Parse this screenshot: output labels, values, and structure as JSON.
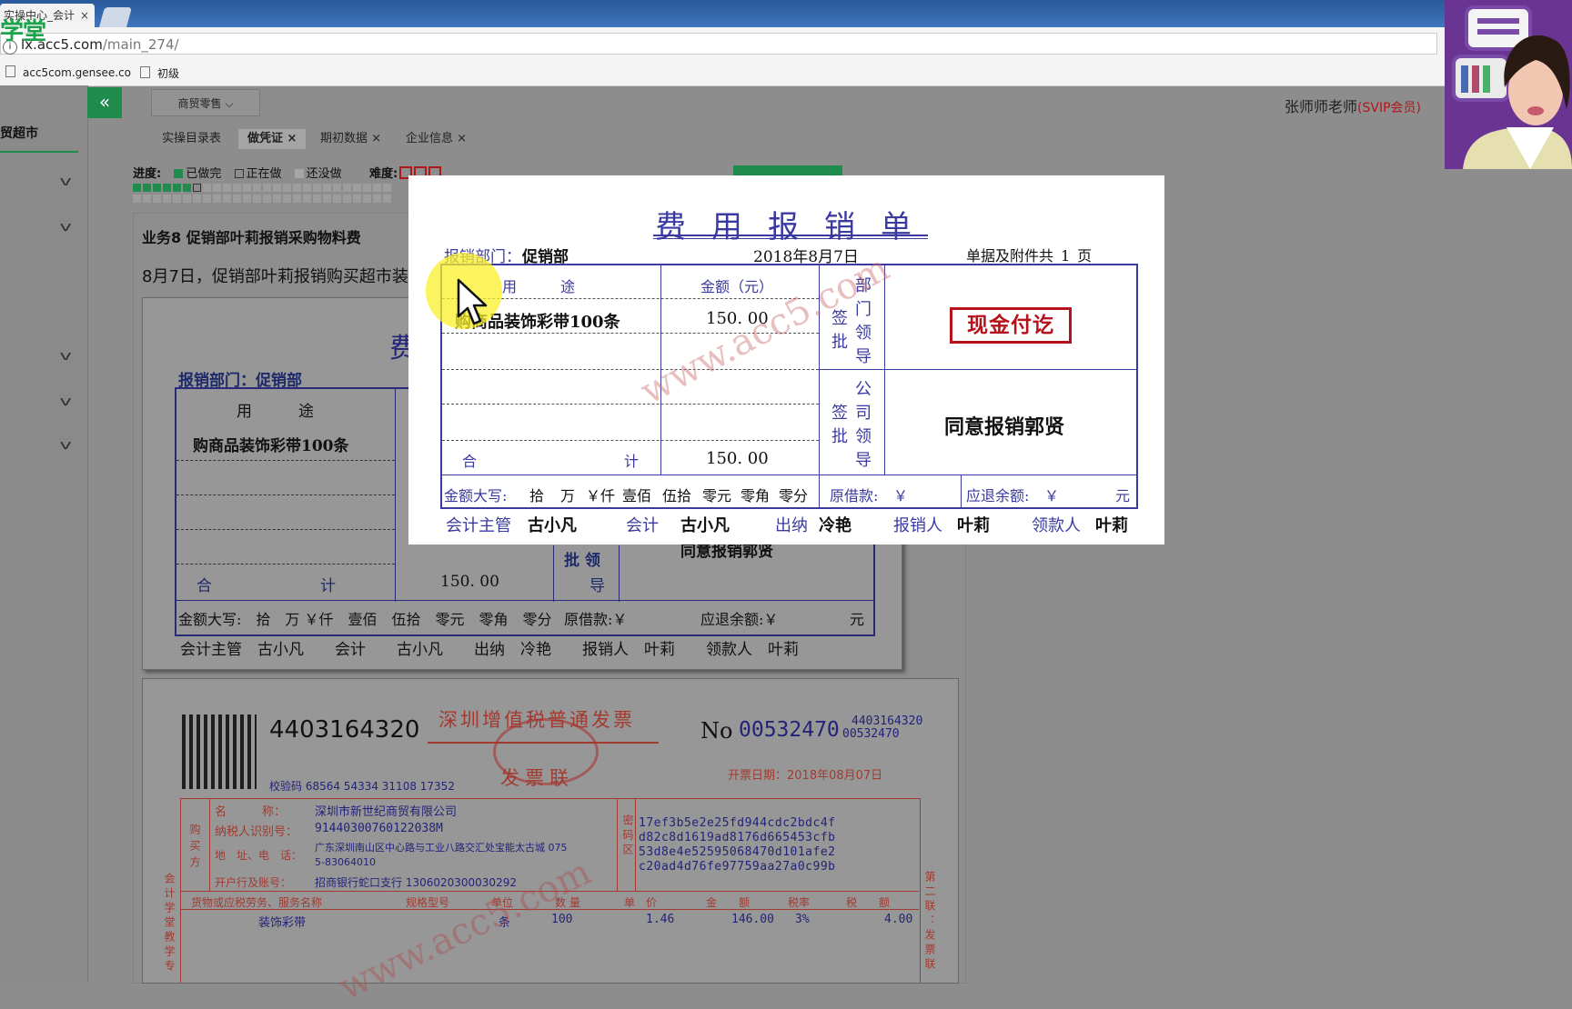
{
  "browser": {
    "tab_title": "实操中心_会计",
    "tab_close": "×",
    "logo_text": "学堂",
    "url_host": "lx.acc5.com",
    "url_path": "/main_274/",
    "bookmarks": [
      "acc5com.gensee.co",
      "初级"
    ]
  },
  "app": {
    "collapse_icon": "«",
    "sidebar_title": "贸超市",
    "trade_button": "商贸零售 ⌵",
    "teacher_name": "张师师老师",
    "teacher_badge": "(SVIP会员)",
    "tabs": [
      {
        "label": "实操目录表",
        "closable": false
      },
      {
        "label": "做凭证",
        "closable": true,
        "active": true
      },
      {
        "label": "期初数据",
        "closable": true
      },
      {
        "label": "企业信息",
        "closable": true
      }
    ],
    "tab_close": "×",
    "progress_label": "进度:",
    "legend": [
      "已做完",
      "正在做",
      "还没做"
    ],
    "difficulty_label": "难度:",
    "progress_done_count": 6,
    "task_title": "业务8 促销部叶莉报销采购物料费",
    "task_desc": "8月7日，促销部叶莉报销购买超市装"
  },
  "bg_form": {
    "title_fragment": "费",
    "dept": "报销部门：促销部",
    "col_use": "用　　　途",
    "item": "购商品装饰彩带100条",
    "total_label": "合　　　　　　　计",
    "total": "150. 00",
    "sign_left": "批 领",
    "sign_dept": "导",
    "approve": "同意报销郭贤",
    "upper_amount": "金额大写:　拾　万 ￥仟　壹佰　伍拾　零元　零角　零分",
    "loan": "原借款:￥",
    "refund": "应退余额:￥",
    "yuan": "元",
    "sign_row": "会计主管　古小凡　　会计　　古小凡　　出纳　冷艳　　报销人　叶莉　　领款人　叶莉"
  },
  "invoice": {
    "code": "4403164320",
    "title": "深圳增值税普通发票",
    "subtitle": "发票联",
    "no_label": "No",
    "number": "00532470",
    "code_small": "4403164320",
    "number_small": "00532470",
    "check_code": "校验码 68564 54334 31108 17352",
    "date": "开票日期：2018年08月07日",
    "buyer_name_label": "名　　　称：",
    "buyer_name": "深圳市新世纪商贸有限公司",
    "taxid_label": "纳税人识别号：",
    "taxid": "91440300760122038M",
    "addr_label": "地　址、电　话：",
    "addr": "广东深圳南山区中心路与工业八路交汇处宝能太古城 075",
    "addr2": "5-83064010",
    "bank_label": "开户行及账号：",
    "bank": "招商银行蛇口支行 1306020300030292",
    "cipher": [
      "17ef3b5e2e25fd944cdc2bdc4f",
      "d82c8d1619ad8176d665453cfb",
      "53d8e4e52595068470d101afe2",
      "c20ad4d76fe97759aa27a0c99b"
    ],
    "col_goods": "货物或应税劳务、服务名称",
    "col_spec": "规格型号",
    "col_unit": "单位",
    "col_qty": "数 量",
    "col_price": "单　价",
    "col_amount": "金　　额",
    "col_rate": "税率",
    "col_tax": "税　　额",
    "row_goods": "装饰彩带",
    "row_unit": "条",
    "row_qty": "100",
    "row_price": "1.46",
    "row_amount": "146.00",
    "row_rate": "3%",
    "row_tax": "4.00",
    "side_buyer": "购买方",
    "side_cipher": "密码区",
    "side_left": "会计学堂教学专",
    "side_right": "第二联：发票联",
    "watermark": "www.acc5.com"
  },
  "modal": {
    "title": "费用报销单",
    "dept_label": "报销部门：",
    "dept": "促销部",
    "date": "2018年8月7日",
    "attach": "单据及附件共_1_页",
    "col_use": "用　　　途",
    "col_amount": "金额（元）",
    "dept_approve_v": [
      "签",
      "批",
      "部",
      "门",
      "领",
      "导"
    ],
    "company_approve_v": [
      "公",
      "签",
      "司",
      "批",
      "领",
      "导"
    ],
    "item": "购商品装饰彩带100条",
    "item_amount": "150. 00",
    "stamp": "现金付讫",
    "approve_text": "同意报销郭贤",
    "total_label": "合",
    "total_label2": "计",
    "total": "150. 00",
    "upper_label": "金额大写:",
    "upper_units": [
      "拾",
      "万",
      "￥仟",
      "壹佰",
      "伍拾",
      "零元",
      "零角",
      "零分"
    ],
    "loan_label": "原借款:",
    "loan_sym": "￥",
    "refund_label": "应退余额:",
    "refund_sym": "￥",
    "yuan": "元",
    "signatures": [
      {
        "label": "会计主管",
        "name": "古小凡"
      },
      {
        "label": "会计",
        "name": "古小凡"
      },
      {
        "label": "出纳",
        "name": "冷艳"
      },
      {
        "label": "报销人",
        "name": "叶莉"
      },
      {
        "label": "领款人",
        "name": "叶莉"
      }
    ],
    "watermark": "www.acc5.com"
  },
  "colors": {
    "accent_green": "#1f8c4e",
    "form_blue": "#3a3aa0",
    "stamp_red": "#b5121b",
    "badge_red": "#b0171b"
  }
}
